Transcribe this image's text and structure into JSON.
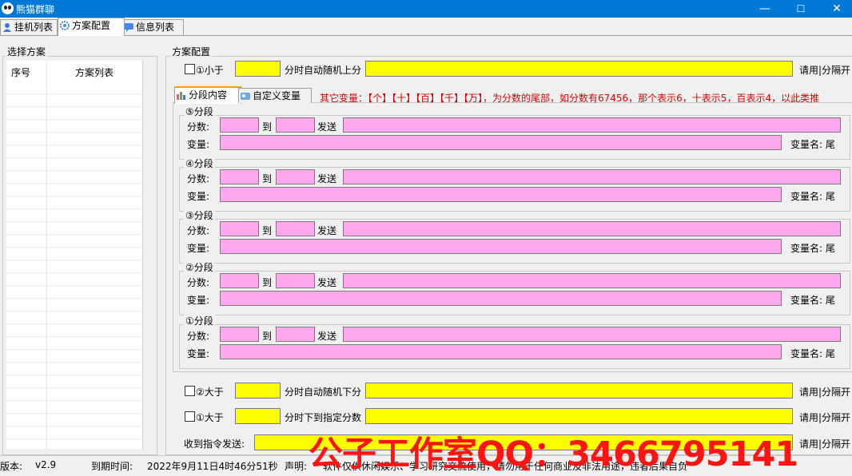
{
  "window": {
    "title": "熊猫群聊",
    "minimize": "—",
    "maximize": "☐",
    "close": "✕"
  },
  "tabs": [
    {
      "label": "挂机列表"
    },
    {
      "label": "方案配置"
    },
    {
      "label": "信息列表"
    }
  ],
  "left": {
    "group_title": "选择方案",
    "col1": "序号",
    "col2": "方案列表"
  },
  "config": {
    "group_title": "方案配置",
    "row_less": {
      "label": "①小于",
      "mid": "分时自动随机上分",
      "right": "请用|分隔开"
    },
    "subtabs": [
      {
        "label": "分段内容"
      },
      {
        "label": "自定义变量"
      }
    ],
    "note": "其它变量：【个】【十】【百】【千】【万】，为分数的尾部，如分数有67456，那个表示6，十表示5，百表示4，以此类推",
    "segments": [
      {
        "title": "⑤分段"
      },
      {
        "title": "④分段"
      },
      {
        "title": "③分段"
      },
      {
        "title": "②分段"
      },
      {
        "title": "①分段"
      }
    ],
    "seg_labels": {
      "score": "分数:",
      "to": "到",
      "send": "发送",
      "var": "变量:",
      "varname": "变量名: 尾"
    },
    "row_gt2": {
      "label": "②大于",
      "mid": "分时自动随机下分",
      "right": "请用|分隔开"
    },
    "row_gt1": {
      "label": "①大于",
      "mid": "分时下到指定分数",
      "right": "请用|分隔开"
    },
    "row_cmd": {
      "label": "收到指令发送:",
      "right": "请用|分隔开"
    }
  },
  "status": {
    "version_label": "版本:",
    "version": "v2.9",
    "expire_label": "到期时间:",
    "expire": "2022年9月11日4时46分51秒",
    "notice_label": "声明:",
    "notice": "软件仅供休闲娱乐、学习研究交流使用，请勿用于任何商业及非法用途，违者后果自负"
  },
  "watermark": "公子工作室QQ：3466795141",
  "colors": {
    "title_bar": "#0078d7",
    "yellow_field": "#ffff00",
    "pink_field": "#ffa8f0",
    "note_red": "#e00000",
    "watermark_red": "#ff1414"
  }
}
